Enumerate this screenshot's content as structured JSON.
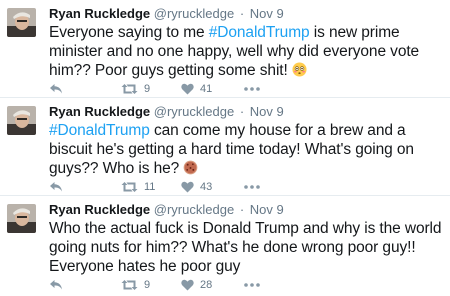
{
  "tweets": [
    {
      "user": {
        "name": "Ryan Ruckledge",
        "handle": "@ryruckledge",
        "separator": "·",
        "date": "Nov 9"
      },
      "text": {
        "before": "Everyone saying to me ",
        "hashtag": "#DonaldTrump",
        "after": " is new prime minister and no one happy, well why did everyone vote him?? Poor guys getting some shit!"
      },
      "emoji": "flushed-face-emoji",
      "actions": {
        "retweets": "9",
        "likes": "41"
      }
    },
    {
      "user": {
        "name": "Ryan Ruckledge",
        "handle": "@ryruckledge",
        "separator": "·",
        "date": "Nov 9"
      },
      "text": {
        "before": "",
        "hashtag": "#DonaldTrump",
        "after": " can come my house for a brew and a biscuit he's getting a hard time today! What's going on guys?? Who is he?"
      },
      "emoji": "cookie-emoji",
      "actions": {
        "retweets": "11",
        "likes": "43"
      }
    },
    {
      "user": {
        "name": "Ryan Ruckledge",
        "handle": "@ryruckledge",
        "separator": "·",
        "date": "Nov 9"
      },
      "text": {
        "before": "Who the actual fuck is Donald Trump and why is the world going nuts for him?? What's he done wrong poor guy!! Everyone hates he poor guy",
        "hashtag": "",
        "after": ""
      },
      "actions": {
        "retweets": "9",
        "likes": "28"
      }
    }
  ],
  "colors": {
    "hashtag": "#1da1f2",
    "icon": "#8899a6",
    "meta": "#657786",
    "divider": "#e6ecf0"
  }
}
